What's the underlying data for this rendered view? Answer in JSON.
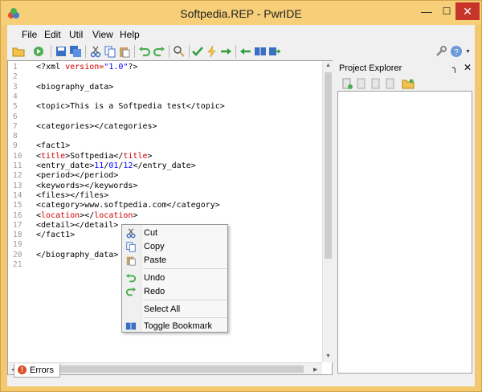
{
  "window": {
    "title": "Softpedia.REP - PwrIDE"
  },
  "menu": {
    "file": "File",
    "edit": "Edit",
    "util": "Util",
    "view": "View",
    "help": "Help"
  },
  "editor": {
    "line_numbers": [
      "1",
      "2",
      "3",
      "4",
      "5",
      "6",
      "7",
      "8",
      "9",
      "10",
      "11",
      "12",
      "13",
      "14",
      "15",
      "16",
      "17",
      "18",
      "19",
      "20",
      "21"
    ],
    "lines": [
      "<?xml version=\"1.0\"?>",
      "",
      "<biography_data>",
      "",
      "<topic>This is a Softpedia test</topic>",
      "",
      "<categories></categories>",
      "",
      "<fact1>",
      "<title>Softpedia</title>",
      "<entry_date>11/01/12</entry_date>",
      "<period></period>",
      "<keywords></keywords>",
      "<files></files>",
      "<category>www.softpedia.com</category>",
      "<location></location>",
      "<detail></detail>",
      "</fact1>",
      "",
      "</biography_data>",
      ""
    ]
  },
  "project_explorer": {
    "title": "Project Explorer"
  },
  "context_menu": {
    "cut": "Cut",
    "copy": "Copy",
    "paste": "Paste",
    "undo": "Undo",
    "redo": "Redo",
    "select_all": "Select All",
    "toggle_bookmark": "Toggle Bookmark"
  },
  "status": {
    "errors_tab": "Errors"
  },
  "colors": {
    "titlebar": "#f7cf78",
    "tag_red": "#d40000",
    "value_blue": "#0000ff",
    "close_btn": "#c7352a"
  }
}
